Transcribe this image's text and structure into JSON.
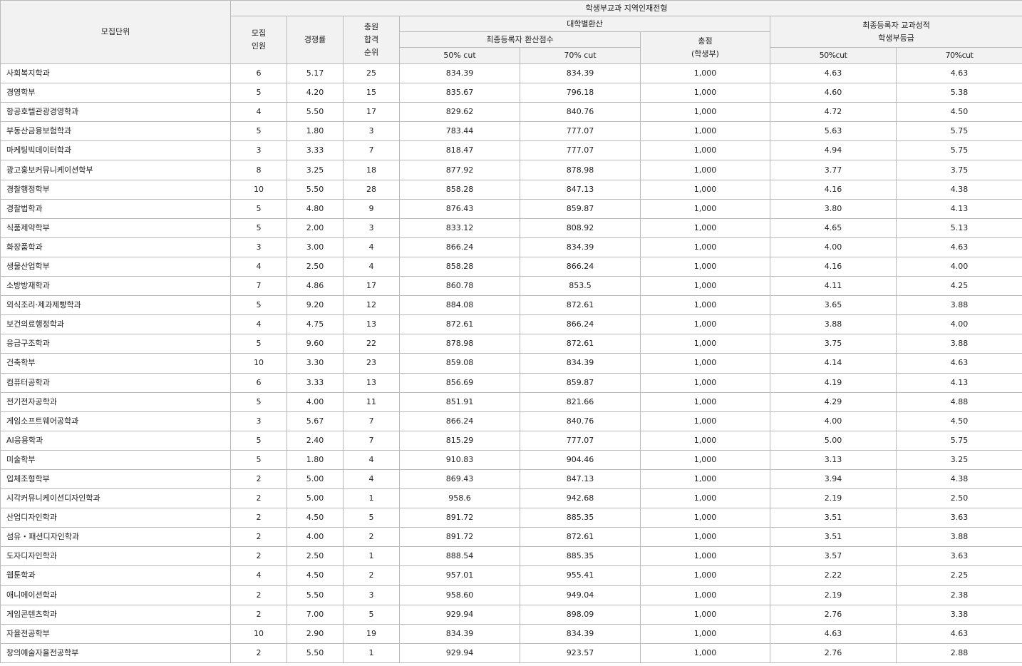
{
  "headers": {
    "unit": "모집단위",
    "group": "학생부교과 지역인재전형",
    "recruit_line1": "모집",
    "recruit_line2": "인원",
    "ratio": "경쟁률",
    "fill_line1": "충원",
    "fill_line2": "합격",
    "fill_line3": "순위",
    "univ_conv": "대학별환산",
    "final_conv": "최종등록자 환산점수",
    "total_line1": "총점",
    "total_line2": "(학생부)",
    "grade_line1": "최종등록자 교과성적",
    "grade_line2": "학생부등급",
    "conv_50": "50% cut",
    "conv_70": "70% cut",
    "grade_50": "50%cut",
    "grade_70": "70%cut"
  },
  "rows": [
    {
      "name": "사회복지학과",
      "recruit": "6",
      "ratio": "5.17",
      "rank": "25",
      "conv50": "834.39",
      "conv70": "834.39",
      "total": "1,000",
      "grade50": "4.63",
      "grade70": "4.63"
    },
    {
      "name": "경영학부",
      "recruit": "5",
      "ratio": "4.20",
      "rank": "15",
      "conv50": "835.67",
      "conv70": "796.18",
      "total": "1,000",
      "grade50": "4.60",
      "grade70": "5.38"
    },
    {
      "name": "항공호텔관광경영학과",
      "recruit": "4",
      "ratio": "5.50",
      "rank": "17",
      "conv50": "829.62",
      "conv70": "840.76",
      "total": "1,000",
      "grade50": "4.72",
      "grade70": "4.50"
    },
    {
      "name": "부동산금융보험학과",
      "recruit": "5",
      "ratio": "1.80",
      "rank": "3",
      "conv50": "783.44",
      "conv70": "777.07",
      "total": "1,000",
      "grade50": "5.63",
      "grade70": "5.75"
    },
    {
      "name": "마케팅빅데이터학과",
      "recruit": "3",
      "ratio": "3.33",
      "rank": "7",
      "conv50": "818.47",
      "conv70": "777.07",
      "total": "1,000",
      "grade50": "4.94",
      "grade70": "5.75"
    },
    {
      "name": "광고홍보커뮤니케이션학부",
      "recruit": "8",
      "ratio": "3.25",
      "rank": "18",
      "conv50": "877.92",
      "conv70": "878.98",
      "total": "1,000",
      "grade50": "3.77",
      "grade70": "3.75"
    },
    {
      "name": "경찰행정학부",
      "recruit": "10",
      "ratio": "5.50",
      "rank": "28",
      "conv50": "858.28",
      "conv70": "847.13",
      "total": "1,000",
      "grade50": "4.16",
      "grade70": "4.38"
    },
    {
      "name": "경찰법학과",
      "recruit": "5",
      "ratio": "4.80",
      "rank": "9",
      "conv50": "876.43",
      "conv70": "859.87",
      "total": "1,000",
      "grade50": "3.80",
      "grade70": "4.13"
    },
    {
      "name": "식품제약학부",
      "recruit": "5",
      "ratio": "2.00",
      "rank": "3",
      "conv50": "833.12",
      "conv70": "808.92",
      "total": "1,000",
      "grade50": "4.65",
      "grade70": "5.13"
    },
    {
      "name": "화장품학과",
      "recruit": "3",
      "ratio": "3.00",
      "rank": "4",
      "conv50": "866.24",
      "conv70": "834.39",
      "total": "1,000",
      "grade50": "4.00",
      "grade70": "4.63"
    },
    {
      "name": "생물산업학부",
      "recruit": "4",
      "ratio": "2.50",
      "rank": "4",
      "conv50": "858.28",
      "conv70": "866.24",
      "total": "1,000",
      "grade50": "4.16",
      "grade70": "4.00"
    },
    {
      "name": "소방방재학과",
      "recruit": "7",
      "ratio": "4.86",
      "rank": "17",
      "conv50": "860.78",
      "conv70": "853.5",
      "total": "1,000",
      "grade50": "4.11",
      "grade70": "4.25"
    },
    {
      "name": "외식조리·제과제빵학과",
      "recruit": "5",
      "ratio": "9.20",
      "rank": "12",
      "conv50": "884.08",
      "conv70": "872.61",
      "total": "1,000",
      "grade50": "3.65",
      "grade70": "3.88"
    },
    {
      "name": "보건의료행정학과",
      "recruit": "4",
      "ratio": "4.75",
      "rank": "13",
      "conv50": "872.61",
      "conv70": "866.24",
      "total": "1,000",
      "grade50": "3.88",
      "grade70": "4.00"
    },
    {
      "name": "응급구조학과",
      "recruit": "5",
      "ratio": "9.60",
      "rank": "22",
      "conv50": "878.98",
      "conv70": "872.61",
      "total": "1,000",
      "grade50": "3.75",
      "grade70": "3.88"
    },
    {
      "name": "건축학부",
      "recruit": "10",
      "ratio": "3.30",
      "rank": "23",
      "conv50": "859.08",
      "conv70": "834.39",
      "total": "1,000",
      "grade50": "4.14",
      "grade70": "4.63"
    },
    {
      "name": "컴퓨터공학과",
      "recruit": "6",
      "ratio": "3.33",
      "rank": "13",
      "conv50": "856.69",
      "conv70": "859.87",
      "total": "1,000",
      "grade50": "4.19",
      "grade70": "4.13"
    },
    {
      "name": "전기전자공학과",
      "recruit": "5",
      "ratio": "4.00",
      "rank": "11",
      "conv50": "851.91",
      "conv70": "821.66",
      "total": "1,000",
      "grade50": "4.29",
      "grade70": "4.88"
    },
    {
      "name": "게임소프트웨어공학과",
      "recruit": "3",
      "ratio": "5.67",
      "rank": "7",
      "conv50": "866.24",
      "conv70": "840.76",
      "total": "1,000",
      "grade50": "4.00",
      "grade70": "4.50"
    },
    {
      "name": "AI응용학과",
      "recruit": "5",
      "ratio": "2.40",
      "rank": "7",
      "conv50": "815.29",
      "conv70": "777.07",
      "total": "1,000",
      "grade50": "5.00",
      "grade70": "5.75"
    },
    {
      "name": "미술학부",
      "recruit": "5",
      "ratio": "1.80",
      "rank": "4",
      "conv50": "910.83",
      "conv70": "904.46",
      "total": "1,000",
      "grade50": "3.13",
      "grade70": "3.25"
    },
    {
      "name": "입체조형학부",
      "recruit": "2",
      "ratio": "5.00",
      "rank": "4",
      "conv50": "869.43",
      "conv70": "847.13",
      "total": "1,000",
      "grade50": "3.94",
      "grade70": "4.38"
    },
    {
      "name": "시각커뮤니케이션디자인학과",
      "recruit": "2",
      "ratio": "5.00",
      "rank": "1",
      "conv50": "958.6",
      "conv70": "942.68",
      "total": "1,000",
      "grade50": "2.19",
      "grade70": "2.50"
    },
    {
      "name": "산업디자인학과",
      "recruit": "2",
      "ratio": "4.50",
      "rank": "5",
      "conv50": "891.72",
      "conv70": "885.35",
      "total": "1,000",
      "grade50": "3.51",
      "grade70": "3.63"
    },
    {
      "name": "섬유・패션디자인학과",
      "recruit": "2",
      "ratio": "4.00",
      "rank": "2",
      "conv50": "891.72",
      "conv70": "872.61",
      "total": "1,000",
      "grade50": "3.51",
      "grade70": "3.88"
    },
    {
      "name": "도자디자인학과",
      "recruit": "2",
      "ratio": "2.50",
      "rank": "1",
      "conv50": "888.54",
      "conv70": "885.35",
      "total": "1,000",
      "grade50": "3.57",
      "grade70": "3.63"
    },
    {
      "name": "웹툰학과",
      "recruit": "4",
      "ratio": "4.50",
      "rank": "2",
      "conv50": "957.01",
      "conv70": "955.41",
      "total": "1,000",
      "grade50": "2.22",
      "grade70": "2.25"
    },
    {
      "name": "애니메이션학과",
      "recruit": "2",
      "ratio": "5.50",
      "rank": "3",
      "conv50": "958.60",
      "conv70": "949.04",
      "total": "1,000",
      "grade50": "2.19",
      "grade70": "2.38"
    },
    {
      "name": "게임콘텐츠학과",
      "recruit": "2",
      "ratio": "7.00",
      "rank": "5",
      "conv50": "929.94",
      "conv70": "898.09",
      "total": "1,000",
      "grade50": "2.76",
      "grade70": "3.38"
    },
    {
      "name": "자율전공학부",
      "recruit": "10",
      "ratio": "2.90",
      "rank": "19",
      "conv50": "834.39",
      "conv70": "834.39",
      "total": "1,000",
      "grade50": "4.63",
      "grade70": "4.63"
    },
    {
      "name": "창의예술자율전공학부",
      "recruit": "2",
      "ratio": "5.50",
      "rank": "1",
      "conv50": "929.94",
      "conv70": "923.57",
      "total": "1,000",
      "grade50": "2.76",
      "grade70": "2.88"
    }
  ]
}
